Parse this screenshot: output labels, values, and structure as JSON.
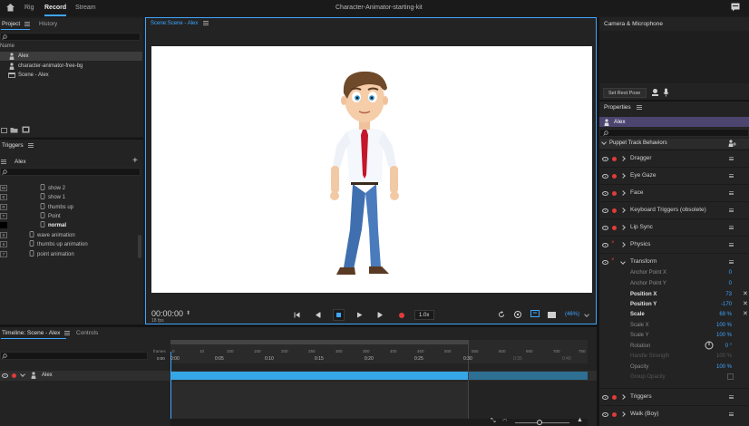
{
  "topbar": {
    "tabs": [
      "Rig",
      "Record",
      "Stream"
    ],
    "active_tab": "Record",
    "title": "Character-Animator-starting-kit"
  },
  "project": {
    "tabs": [
      "Project",
      "History"
    ],
    "col_header": "Name",
    "items": [
      "Alex",
      "character-animator-free-bg",
      "Scene - Alex"
    ]
  },
  "triggers": {
    "title": "Triggers",
    "puppet": "Alex",
    "items": [
      {
        "key": "W",
        "label": "show 2"
      },
      {
        "key": "E",
        "label": "show 1"
      },
      {
        "key": "R",
        "label": "thumbs up"
      },
      {
        "key": "T",
        "label": "Point"
      },
      {
        "key": "",
        "label": "normal"
      },
      {
        "key": "S",
        "label": "wave animation"
      },
      {
        "key": "6",
        "label": "thumbs up animation"
      },
      {
        "key": "7",
        "label": "point animation"
      }
    ]
  },
  "scene": {
    "label": "Scene:",
    "name": "Scene - Alex",
    "timecode": "00:00:00",
    "fps": "18 fps",
    "speed": "1.0x",
    "zoom": "(46%)"
  },
  "camera": {
    "title": "Camera & Microphone",
    "rest_pose": "Set Rest Pose"
  },
  "properties": {
    "title": "Properties",
    "puppet": "Alex",
    "section": "Puppet Track Behaviors",
    "behaviors": [
      "Dragger",
      "Eye Gaze",
      "Face",
      "Keyboard Triggers (obsolete)",
      "Lip Sync",
      "Physics",
      "Transform"
    ],
    "transform_props": [
      {
        "label": "Anchor Point X",
        "value": "0",
        "style": ""
      },
      {
        "label": "Anchor Point Y",
        "value": "0",
        "style": ""
      },
      {
        "label": "Position X",
        "value": "73",
        "style": "bold"
      },
      {
        "label": "Position Y",
        "value": "-170",
        "style": "bold"
      },
      {
        "label": "Scale",
        "value": "69 %",
        "style": "bold"
      },
      {
        "label": "Scale X",
        "value": "100 %",
        "style": ""
      },
      {
        "label": "Scale Y",
        "value": "100 %",
        "style": ""
      },
      {
        "label": "Rotation",
        "value": "0 °",
        "style": ""
      },
      {
        "label": "Handle Strength",
        "value": "100 %",
        "style": "dim"
      },
      {
        "label": "Opacity",
        "value": "100 %",
        "style": ""
      },
      {
        "label": "Group Opacity",
        "value": "",
        "style": "dim"
      }
    ],
    "after": [
      "Triggers",
      "Walk (Boy)"
    ]
  },
  "timeline": {
    "tabs": [
      "Timeline: Scene - Alex",
      "Controls"
    ],
    "frames_label": "frames",
    "frame_ticks": [
      "0",
      "10",
      "100",
      "150",
      "200",
      "250",
      "300",
      "350",
      "400",
      "450",
      "500",
      "550",
      "600",
      "650",
      "700",
      "750"
    ],
    "time_ticks": [
      "0:00",
      "0:05",
      "0:10",
      "0:15",
      "0:20",
      "0:25",
      "0:30",
      "0:35",
      "0:40"
    ],
    "track": "Alex",
    "zero": "0",
    "frame_count": "0:00"
  },
  "colors": {
    "accent": "#3ea6ff",
    "record": "#e23b3b",
    "puppet_header": "#4b4570",
    "track_bar": "#35a6e6"
  }
}
